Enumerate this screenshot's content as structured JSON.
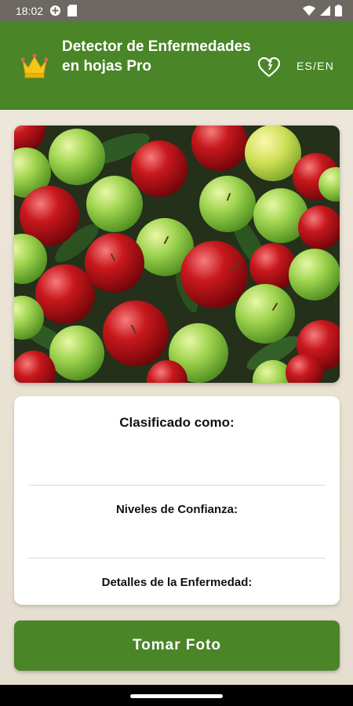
{
  "status_bar": {
    "time": "18:02",
    "icons": [
      "app-notification-icon",
      "sd-card-icon",
      "wifi-icon",
      "signal-icon",
      "battery-icon"
    ]
  },
  "app_bar": {
    "title": "Detector de Enfermedades en hojas Pro",
    "lang_toggle": "ES/EN",
    "icons": [
      "crown-icon",
      "heart-icon"
    ],
    "color": "#4a8527"
  },
  "image": {
    "description_icon": "apples-photo"
  },
  "results": {
    "classified_label": "Clasificado como:",
    "classified_value": "",
    "confidence_label": "Niveles de Confianza:",
    "confidence_value": "",
    "details_label": "Detalles de la Enfermedad:",
    "details_value": ""
  },
  "actions": {
    "take_photo_label": "Tomar Foto",
    "color": "#4a8527"
  }
}
